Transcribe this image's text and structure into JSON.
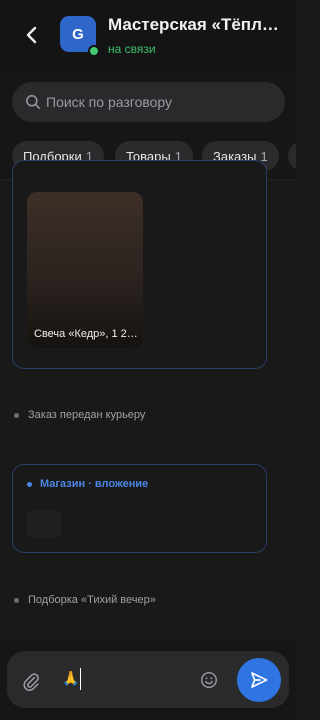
{
  "header": {
    "back_icon": "chevron-left-icon",
    "avatar_letter": "G",
    "title": "Мастерская «Тёплый свет»",
    "status": "на связи",
    "status_color": "#3fbf6e",
    "avatar_color": "#2f66c9"
  },
  "search": {
    "placeholder": "Поиск по разговору",
    "value": ""
  },
  "filters": [
    {
      "label": "Подборки",
      "count": "1"
    },
    {
      "label": "Товары",
      "count": "1"
    },
    {
      "label": "Заказы",
      "count": "1"
    }
  ],
  "feed": {
    "product_card": {
      "label": "Свеча «Кедр», 1 2…"
    },
    "event_1": "Заказ передан курьеру",
    "attachment_card": {
      "header": "Магазин · вложение"
    },
    "event_2": "Подборка «Тихий вечер»"
  },
  "composer": {
    "value": "🙏",
    "attach_icon": "paperclip-icon",
    "emoji_icon": "smiley-icon",
    "send_icon": "send-icon",
    "accent": "#2f74e0"
  }
}
